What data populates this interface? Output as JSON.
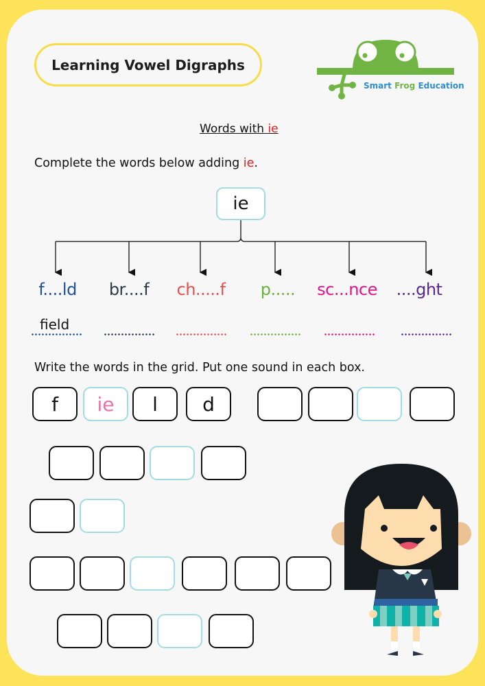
{
  "header": {
    "title": "Learning Vowel Digraphs",
    "logo": {
      "text_part1": "Smart ",
      "text_part2": "Frog",
      "text_part3": " Education",
      "icon": "frog-logo-icon"
    }
  },
  "subtitle": {
    "text": "Words with ",
    "highlight": "ie"
  },
  "instruction1": {
    "text": "Complete the words below adding ",
    "highlight": "ie",
    "end": "."
  },
  "root": {
    "label": "ie"
  },
  "words": [
    {
      "text": "f....ld",
      "color": "#1d4f9e"
    },
    {
      "text": "br....f",
      "color": "#2b3a4a"
    },
    {
      "text": "ch.....f",
      "color": "#ea4e4e"
    },
    {
      "text": "p.....",
      "color": "#6ab23c"
    },
    {
      "text": "sc...nce",
      "color": "#e2168a"
    },
    {
      "text": "....ght",
      "color": "#5a2791"
    }
  ],
  "example_answer": "field",
  "instruction2": {
    "text": "Write the words in the grid. Put one sound in each box."
  },
  "grid_example": [
    "f",
    "ie",
    "l",
    "d"
  ],
  "colors": {
    "border": "#fce35a",
    "vowel_box": "#a3dbe3",
    "vowel_text": "#ee70a6",
    "highlight": "#e0201f"
  }
}
